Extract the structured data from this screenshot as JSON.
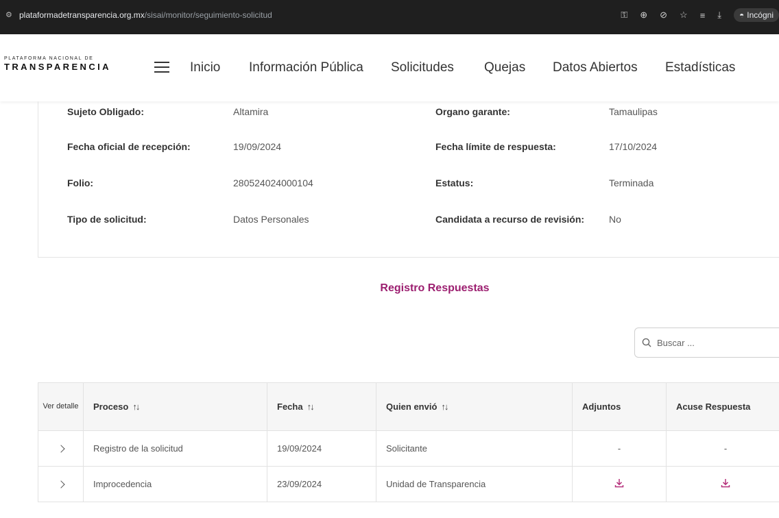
{
  "browser": {
    "url_domain": "plataformadetransparencia.org.mx",
    "url_path": "/sisai/monitor/seguimiento-solicitud",
    "incognito_label": "Incógni"
  },
  "header": {
    "logo_top": "PLATAFORMA NACIONAL DE",
    "logo_main": "TRANSPARENCIA",
    "nav": [
      "Inicio",
      "Información Pública",
      "Solicitudes",
      "Quejas",
      "Datos Abiertos",
      "Estadísticas"
    ]
  },
  "info": {
    "sujeto_label": "Sujeto Obligado:",
    "sujeto_value": "Altamira",
    "organo_label": "Organo garante:",
    "organo_value": "Tamaulipas",
    "fecha_recepcion_label": "Fecha oficial de recepción:",
    "fecha_recepcion_value": "19/09/2024",
    "fecha_limite_label": "Fecha límite de respuesta:",
    "fecha_limite_value": "17/10/2024",
    "folio_label": "Folio:",
    "folio_value": "280524024000104",
    "estatus_label": "Estatus:",
    "estatus_value": "Terminada",
    "tipo_label": "Tipo de solicitud:",
    "tipo_value": "Datos Personales",
    "candidata_label": "Candidata a recurso de revisión:",
    "candidata_value": "No"
  },
  "section_title": "Registro Respuestas",
  "search": {
    "placeholder": "Buscar ..."
  },
  "table": {
    "headers": {
      "ver_detalle": "Ver detalle",
      "proceso": "Proceso",
      "fecha": "Fecha",
      "quien": "Quien envió",
      "adjuntos": "Adjuntos",
      "acuse": "Acuse Respuesta"
    },
    "sort_glyph": "↑↓",
    "rows": [
      {
        "proceso": "Registro de la solicitud",
        "fecha": "19/09/2024",
        "quien": "Solicitante",
        "adjuntos": "-",
        "acuse": "-"
      },
      {
        "proceso": "Improcedencia",
        "fecha": "23/09/2024",
        "quien": "Unidad de Transparencia",
        "adjuntos": "",
        "acuse": ""
      }
    ]
  },
  "colors": {
    "accent": "#9c1f70",
    "download": "#b5307b"
  }
}
